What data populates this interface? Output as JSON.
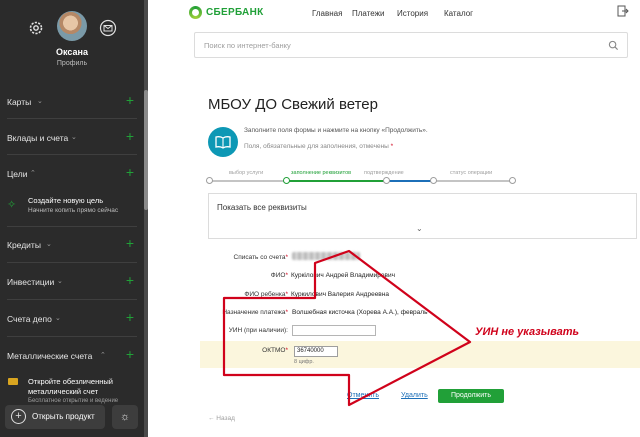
{
  "sidebar": {
    "user_name": "Оксана",
    "user_sub": "Профиль",
    "menu": [
      {
        "label": "Карты"
      },
      {
        "label": "Вклады и счета"
      },
      {
        "label": "Цели"
      },
      {
        "label": "Кредиты"
      },
      {
        "label": "Инвестиции"
      },
      {
        "label": "Счета депо"
      },
      {
        "label": "Металлические счета"
      }
    ],
    "goal": {
      "title": "Создайте новую цель",
      "subtitle": "Начните копить прямо сейчас"
    },
    "metal_promo": {
      "title": "Откройте обезличенный металлический счет",
      "subtitle": "Бесплатное открытие и ведение"
    },
    "open_product": "Открыть продукт",
    "icons": {
      "settings": "gear-icon",
      "mail": "mail-icon",
      "theme": "sun-icon"
    }
  },
  "header": {
    "logo": "СБЕРБАНК",
    "nav": [
      "Главная",
      "Платежи",
      "История",
      "Каталог"
    ],
    "search_placeholder": "Поиск по интернет-банку"
  },
  "form": {
    "title": "МБОУ ДО Свежий ветер",
    "hint": "Заполните поля формы и нажмите на кнопку «Продолжить».",
    "required_hint": "Поля, обязательные для заполнения, отмечены",
    "required_mark": "*",
    "steps": [
      "выбор услуги",
      "заполнение реквизитов",
      "подтверждение",
      "статус операции"
    ],
    "show_all": "Показать все реквизиты",
    "fields": {
      "account": {
        "label": "Списать со счета",
        "value": ""
      },
      "fio": {
        "label": "ФИО",
        "value": "Куркілович Андрей Владимирович"
      },
      "child": {
        "label": "ФИО ребенка",
        "value": "Куркилович Валерия Андреевна"
      },
      "purpose": {
        "label": "Назначение платежа",
        "value": "Волшебная кисточка (Хорева А.А.), февраль"
      },
      "uin": {
        "label": "УИН (при наличии):",
        "value": ""
      },
      "oktmo": {
        "label": "ОКТМО",
        "value": "36740000",
        "sub": "8 цифр."
      }
    },
    "actions": {
      "cancel": "Отменить",
      "delete": "Удалить",
      "continue": "Продолжить",
      "back": "← Назад"
    }
  },
  "annotation": {
    "text": "УИН не указывать",
    "color": "#d0021b"
  },
  "colors": {
    "brand": "#21a038",
    "sidebar_bg": "#2b2b2b",
    "link": "#1c6fb8",
    "highlight": "#fbf6dd"
  }
}
